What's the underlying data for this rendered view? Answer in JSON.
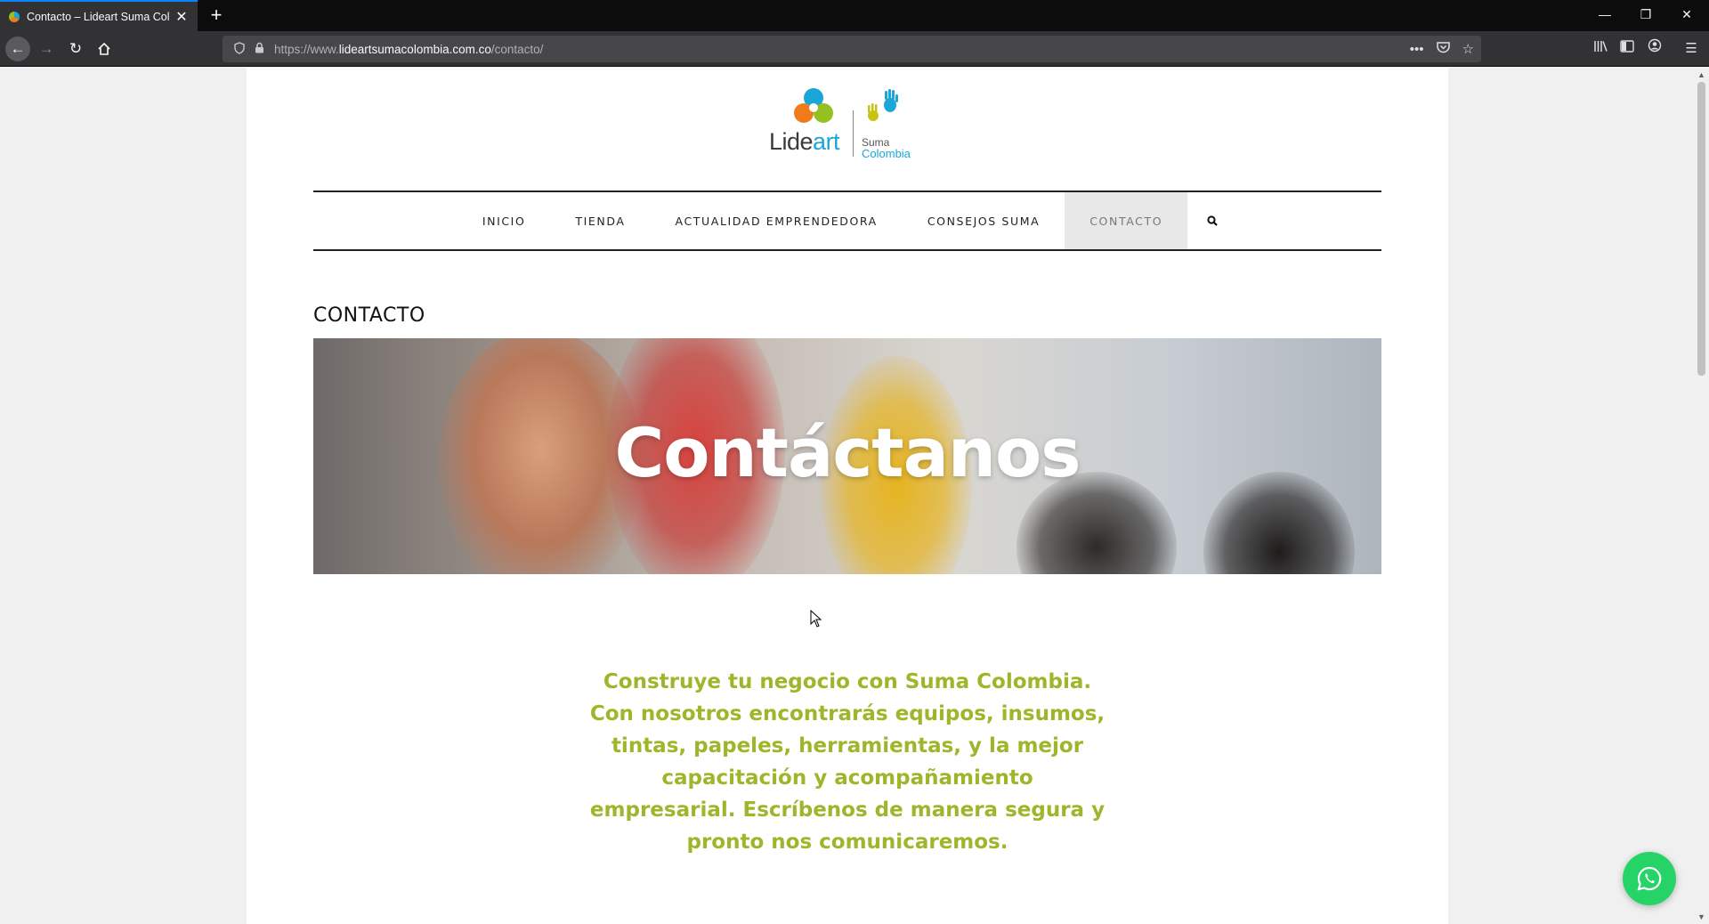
{
  "browser": {
    "tab_title": "Contacto – Lideart Suma Colombia",
    "new_tab_symbol": "+",
    "url_prefix": "https://www.",
    "url_host": "lideartsumacolombia.com.co",
    "url_path": "/contacto/",
    "icons": [
      "back-icon",
      "forward-icon",
      "reload-icon",
      "home-icon",
      "shield-icon",
      "lock-icon",
      "more-icon",
      "pocket-icon",
      "star-icon",
      "library-icon",
      "sidebar-icon",
      "account-icon",
      "menu-icon"
    ]
  },
  "site": {
    "logo_word_a": "Lide",
    "logo_word_b": "art",
    "logo_suma": "Suma",
    "logo_colombia": "Colombia",
    "menu": [
      {
        "label": "INICIO"
      },
      {
        "label": "TIENDA"
      },
      {
        "label": "ACTUALIDAD EMPRENDEDORA"
      },
      {
        "label": "CONSEJOS SUMA"
      },
      {
        "label": "CONTACTO",
        "active": true
      }
    ],
    "page_heading": "CONTACTO",
    "hero_title": "Contáctanos",
    "intro_text": "Construye tu negocio con Suma Colombia. Con nosotros encontrarás equipos, insumos, tintas, papeles, herramientas, y la mejor capacitación y acompañamiento empresarial. Escríbenos de manera segura y pronto nos comunicaremos."
  },
  "colors": {
    "accent_green": "#9fb52a",
    "whatsapp": "#25d366",
    "brand_blue": "#1aa7d8",
    "brand_orange": "#f07b1d"
  }
}
